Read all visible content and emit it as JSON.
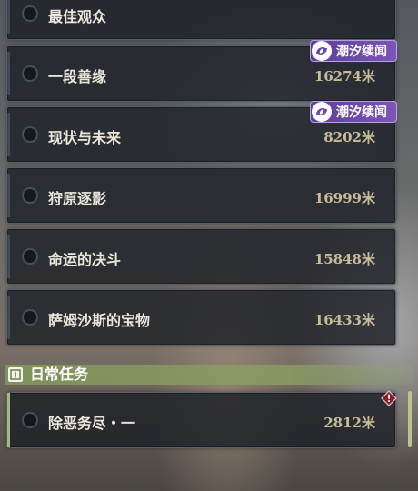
{
  "quests": [
    {
      "name": "最佳观众",
      "distance": "",
      "badge": ""
    },
    {
      "name": "一段善缘",
      "distance": "16274米",
      "badge": "潮汐续闻"
    },
    {
      "name": "现状与未来",
      "distance": "8202米",
      "badge": "潮汐续闻"
    },
    {
      "name": "狩原逐影",
      "distance": "16999米",
      "badge": ""
    },
    {
      "name": "命运的决斗",
      "distance": "15848米",
      "badge": ""
    },
    {
      "name": "萨姆沙斯的宝物",
      "distance": "16433米",
      "badge": ""
    }
  ],
  "daily": {
    "section_title": "日常任务",
    "quest": {
      "name": "除恶务尽・一",
      "distance": "2812米"
    }
  },
  "colors": {
    "badge_purple": "#6a4aa8",
    "daily_green": "#8a9c64",
    "distance_gold": "#c9bd99"
  }
}
